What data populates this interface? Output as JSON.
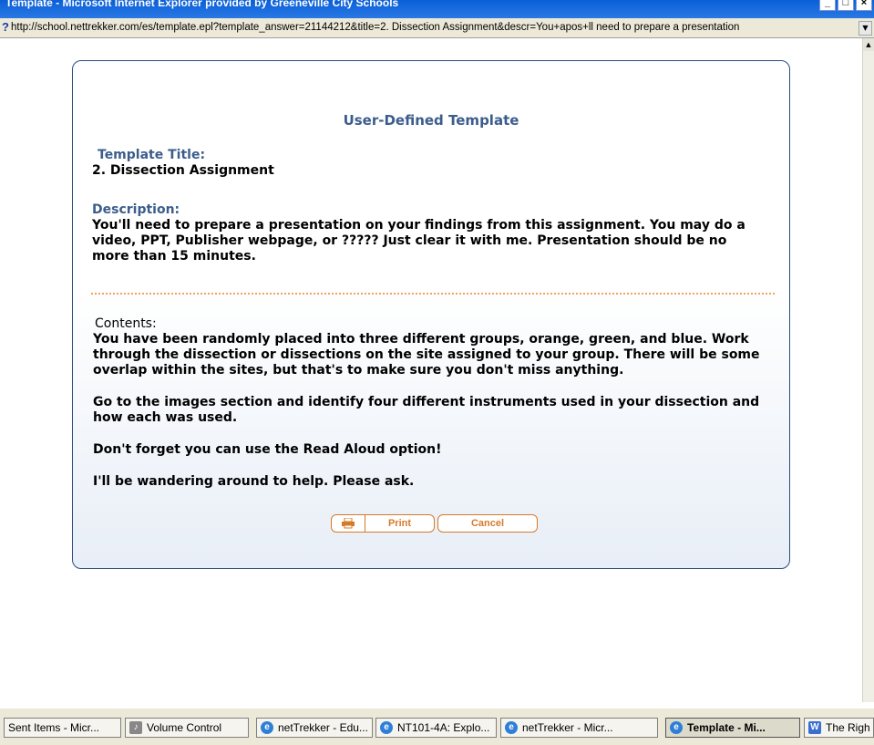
{
  "window": {
    "title": "Template - Microsoft Internet Explorer provided by Greeneville City Schools",
    "url": "http://school.nettrekker.com/es/template.epl?template_answer=21144212&title=2. Dissection Assignment&descr=You+apos+ll need to prepare a presentation"
  },
  "dialog": {
    "heading": "User-Defined Template",
    "title_label": "Template Title:",
    "title_value": "2. Dissection Assignment",
    "description_label": "Description:",
    "description_value": "You'll need to prepare a presentation on your findings from this assignment. You may do a video, PPT, Publisher webpage, or ????? Just clear it with me. Presentation should be no more than 15 minutes.",
    "contents_label": "Contents:",
    "contents_paragraphs": [
      "You have been randomly placed into three different groups, orange, green, and blue. Work through the dissection or dissections on the site assigned to your group. There will be some overlap within the sites, but that's to make sure you don't miss anything.",
      "Go to the images section and identify four different instruments used in your dissection and how each was used.",
      "Don't forget you can use the Read Aloud option!",
      "I'll be wandering around to help. Please ask."
    ],
    "print_label": "Print",
    "cancel_label": "Cancel"
  },
  "taskbar": {
    "items": [
      "Sent Items - Micr...",
      "Volume Control",
      "netTrekker - Edu...",
      "NT101-4A: Explo...",
      "netTrekker - Micr...",
      "Template - Mi...",
      "The Righ"
    ]
  },
  "colors": {
    "accent": "#3c5d8c",
    "button": "#d67a2a",
    "divider": "#f0a35a"
  }
}
